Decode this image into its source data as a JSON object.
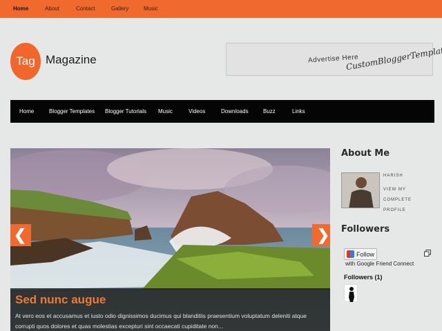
{
  "top_nav": {
    "items": [
      "Home",
      "About",
      "Contact",
      "Gallery",
      "Music"
    ]
  },
  "logo": {
    "badge": "Tag",
    "name": "Magazine"
  },
  "ad": {
    "line1": "Advertise Here",
    "line2": "CustomBloggerTemplates"
  },
  "main_nav": {
    "items": [
      "Home",
      "Blogger Templates",
      "Blogger Tutorials",
      "Music",
      "Videos",
      "Downloads",
      "Buzz",
      "Links"
    ]
  },
  "slider": {
    "title": "Sed nunc augue",
    "text": "At vero eos et accusamus et iusto odio dignissimos ducimus qui blanditiis praesentium voluptatum deleniti atque corrupti quos dolores et quas molestias excepturi sint occaecati cupiditate non...",
    "prev_glyph": "❮",
    "next_glyph": "❯"
  },
  "sidebar": {
    "about_heading": "About Me",
    "profile_name": "HARISH",
    "profile_link": "VIEW MY COMPLETE PROFILE",
    "followers_heading": "Followers",
    "follow_button": "Follow",
    "follow_subtext": "with Google Friend Connect",
    "followers_count": "Followers (1)"
  },
  "colors": {
    "accent": "#f06a2e",
    "nav_bg": "#050505",
    "page_bg": "#e6e8e7"
  }
}
